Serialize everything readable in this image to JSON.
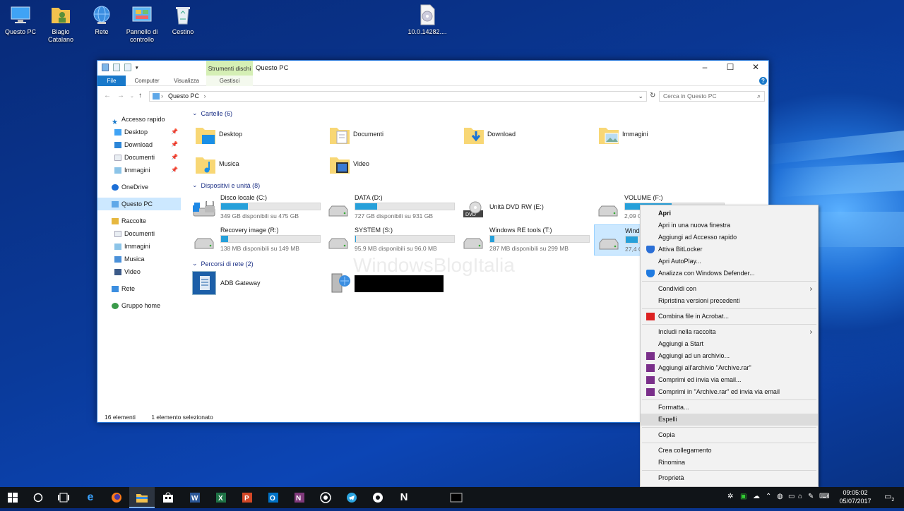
{
  "desktop": {
    "icons": [
      {
        "label": "Questo PC"
      },
      {
        "label": "Biagio Catalano"
      },
      {
        "label": "Rete"
      },
      {
        "label": "Pannello di controllo"
      },
      {
        "label": "Cestino"
      },
      {
        "label": "10.0.14282...."
      }
    ]
  },
  "explorer": {
    "context_header": "Strumenti dischi",
    "title": "Questo PC",
    "ribbon_tabs": [
      "File",
      "Computer",
      "Visualizza",
      "Gestisci"
    ],
    "address": "Questo PC",
    "search_placeholder": "Cerca in Questo PC",
    "nav": [
      {
        "label": "Accesso rapido"
      },
      {
        "label": "Desktop"
      },
      {
        "label": "Download"
      },
      {
        "label": "Documenti"
      },
      {
        "label": "Immagini"
      },
      {
        "label": "OneDrive"
      },
      {
        "label": "Questo PC"
      },
      {
        "label": "Raccolte"
      },
      {
        "label": "Documenti"
      },
      {
        "label": "Immagini"
      },
      {
        "label": "Musica"
      },
      {
        "label": "Video"
      },
      {
        "label": "Rete"
      },
      {
        "label": "Gruppo home"
      }
    ],
    "groups": {
      "folders": "Cartelle (6)",
      "devices": "Dispositivi e unità (8)",
      "network": "Percorsi di rete (2)"
    },
    "folders": [
      "Desktop",
      "Documenti",
      "Download",
      "Immagini",
      "Musica",
      "Video"
    ],
    "drives": [
      {
        "name": "Disco locale (C:)",
        "space": "349 GB disponibili su 475 GB",
        "used": 0.27
      },
      {
        "name": "DATA (D:)",
        "space": "727 GB disponibili su 931 GB",
        "used": 0.22
      },
      {
        "name": "Unità DVD RW (E:)",
        "space": "",
        "used": null
      },
      {
        "name": "VOLUME (F:)",
        "space": "2,09 G",
        "used": 0.47
      },
      {
        "name": "Recovery image (R:)",
        "space": "138 MB disponibili su 149 MB",
        "used": 0.07
      },
      {
        "name": "SYSTEM (S:)",
        "space": "95,9 MB disponibili su 96,0 MB",
        "used": 0.01
      },
      {
        "name": "Windows RE tools (T:)",
        "space": "287 MB disponibili su 299 MB",
        "used": 0.04
      },
      {
        "name": "Windo",
        "space": "27,4 G",
        "used": 0.12
      }
    ],
    "network": [
      {
        "name": "ADB Gateway"
      }
    ],
    "watermark": "WindowsBlogItalia",
    "status_count": "16 elementi",
    "status_selected": "1 elemento selezionato"
  },
  "context_menu": [
    {
      "label": "Apri",
      "bold": true
    },
    {
      "label": "Apri in una nuova finestra"
    },
    {
      "label": "Aggiungi ad Accesso rapido"
    },
    {
      "label": "Attiva BitLocker",
      "icon": "shield-icon"
    },
    {
      "label": "Apri AutoPlay..."
    },
    {
      "label": "Analizza con Windows Defender...",
      "icon": "defender-icon"
    },
    {
      "sep": true
    },
    {
      "label": "Condividi con",
      "submenu": true
    },
    {
      "label": "Ripristina versioni precedenti"
    },
    {
      "sep": true
    },
    {
      "label": "Combina file in Acrobat...",
      "icon": "acrobat-icon"
    },
    {
      "sep": true
    },
    {
      "label": "Includi nella raccolta",
      "submenu": true
    },
    {
      "label": "Aggiungi a Start"
    },
    {
      "label": "Aggiungi ad un archivio...",
      "icon": "winrar-icon"
    },
    {
      "label": "Aggiungi all'archivio \"Archive.rar\"",
      "icon": "winrar-icon"
    },
    {
      "label": "Comprimi ed invia via email...",
      "icon": "winrar-icon"
    },
    {
      "label": "Comprimi in \"Archive.rar\" ed invia via email",
      "icon": "winrar-icon"
    },
    {
      "sep": true
    },
    {
      "label": "Formatta..."
    },
    {
      "label": "Espelli",
      "highlighted": true
    },
    {
      "sep": true
    },
    {
      "label": "Copia"
    },
    {
      "sep": true
    },
    {
      "label": "Crea collegamento"
    },
    {
      "label": "Rinomina"
    },
    {
      "sep": true
    },
    {
      "label": "Proprietà"
    }
  ],
  "taskbar": {
    "apps": [
      "start-icon",
      "cortana-icon",
      "task-view-icon",
      "edge-icon",
      "firefox-icon",
      "file-explorer-icon",
      "store-icon",
      "word-icon",
      "excel-icon",
      "powerpoint-icon",
      "outlook-icon",
      "onenote-icon",
      "whatsapp-icon",
      "telegram-icon",
      "app-icon",
      "notion-icon",
      "terminal-icon"
    ],
    "time": "09:05:02",
    "date": "05/07/2017",
    "notifications": "2"
  },
  "colors": {
    "accent": "#1979ca",
    "selection": "#cce8ff",
    "drive_bar": "#26a0da",
    "context_tab": "#d5efb5"
  }
}
